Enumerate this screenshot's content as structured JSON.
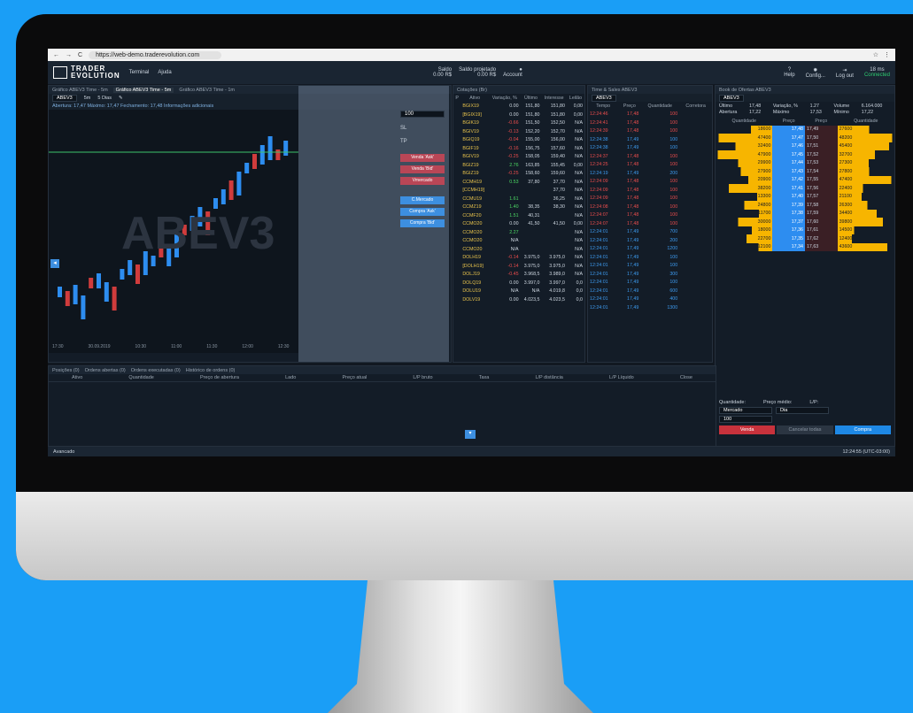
{
  "browser": {
    "url": "https://web-demo.traderevolution.com"
  },
  "header": {
    "logo_top": "TRADER",
    "logo_bottom": "EVOLUTION",
    "menu": [
      "Terminal",
      "Ajuda"
    ],
    "saldo_label": "Saldo",
    "saldo_value": "0.00 R$",
    "proj_label": "Saldo projetado",
    "proj_value": "0.00 R$",
    "account": "Account",
    "help": "Help",
    "config": "Config...",
    "logout": "Log out",
    "latency": "18 ms",
    "connected": "Connected"
  },
  "chart": {
    "tabs": [
      "Gráfico ABEV3 Time - 5m",
      "Gráfico ABEV3 Time - 5m",
      "Gráfico ABEV3 Time - 1m"
    ],
    "symbol": "ABEV3",
    "interval": "5m",
    "period": "5 Dias",
    "info": "Abertura: 17,47  Máximo: 17,47  Fechamento: 17,48  Informações adicionais",
    "watermark": "ABEV3",
    "qty": "100",
    "sl": "SL",
    "tp": "TP",
    "buttons": [
      "Venda 'Ask'",
      "Venda 'Bid'",
      "Vmercado",
      "C.Mercado",
      "Compra 'Ask'",
      "Compra 'Bid'"
    ],
    "times": [
      "17:30",
      "30.09.2019",
      "10:30",
      "11:00",
      "11:30",
      "12:00",
      "12:30"
    ]
  },
  "watch": {
    "title": "Cotações (Br)",
    "headers": [
      "P",
      "Ativo",
      "Variação, %",
      "Último",
      "Interesse",
      "Leilão"
    ],
    "rows": [
      [
        "BGIX19",
        "0.00",
        "151,80",
        "151,80",
        "0,00"
      ],
      [
        "[BGIX19]",
        "0.00",
        "151,80",
        "151,80",
        "0,00"
      ],
      [
        "BGIK19",
        "-0.66",
        "151,50",
        "152,50",
        "N/A"
      ],
      [
        "BGIV19",
        "-0.13",
        "152,20",
        "152,70",
        "N/A"
      ],
      [
        "BGIQ19",
        "-0.04",
        "155,00",
        "156,00",
        "N/A"
      ],
      [
        "BGIF19",
        "-0.16",
        "156,75",
        "157,60",
        "N/A"
      ],
      [
        "BGIV19",
        "-0.25",
        "158,05",
        "159,40",
        "N/A"
      ],
      [
        "BGIZ19",
        "2.76",
        "163,85",
        "155,45",
        "0,00"
      ],
      [
        "BGIZ19",
        "-0.25",
        "158,60",
        "159,60",
        "N/A"
      ],
      [
        "CCMH19",
        "0.53",
        "37,80",
        "37,70",
        "N/A"
      ],
      [
        "[CCMH19]",
        "",
        "",
        "37,70",
        "N/A"
      ],
      [
        "CCMU19",
        "1.61",
        "",
        "36,25",
        "N/A"
      ],
      [
        "CCMZ19",
        "1.40",
        "38,35",
        "38,30",
        "N/A"
      ],
      [
        "CCMF20",
        "1.51",
        "40,31",
        "",
        "N/A"
      ],
      [
        "CCMO20",
        "0.00",
        "41,50",
        "41,50",
        "0,00"
      ],
      [
        "CCMO20",
        "2.27",
        "",
        "",
        "N/A"
      ],
      [
        "CCMO20",
        "N/A",
        "",
        "",
        "N/A"
      ],
      [
        "CCMO20",
        "N/A",
        "",
        "",
        "N/A"
      ],
      [
        "DOLH19",
        "-0.14",
        "3.975,0",
        "3.975,0",
        "N/A"
      ],
      [
        "[DOLH19]",
        "-0.14",
        "3.975,0",
        "3.975,0",
        "N/A"
      ],
      [
        "DOLJ19",
        "-0.45",
        "3.968,5",
        "3.989,0",
        "N/A"
      ],
      [
        "DOLQ19",
        "0.00",
        "3.997,0",
        "3.997,0",
        "0,0"
      ],
      [
        "DOLU19",
        "N/A",
        "N/A",
        "4.019,8",
        "0,0"
      ],
      [
        "DOLV19",
        "0.00",
        "4.023,5",
        "4.023,5",
        "0,0"
      ]
    ]
  },
  "ts": {
    "title": "Time & Sales ABEV3",
    "symbol": "ABEV3",
    "headers": [
      "Tempo",
      "Preço",
      "Quantidade",
      "Corretora"
    ],
    "rows": [
      [
        "12:24:46",
        "17,48",
        "100"
      ],
      [
        "12:24:41",
        "17,48",
        "100"
      ],
      [
        "12:24:39",
        "17,48",
        "100"
      ],
      [
        "12:24:38",
        "17,49",
        "100"
      ],
      [
        "12:24:38",
        "17,49",
        "100"
      ],
      [
        "12:24:37",
        "17,48",
        "100"
      ],
      [
        "12:24:25",
        "17,48",
        "100"
      ],
      [
        "12:24:19",
        "17,49",
        "200"
      ],
      [
        "12:24:09",
        "17,48",
        "100"
      ],
      [
        "12:24:09",
        "17,48",
        "100"
      ],
      [
        "12:24:09",
        "17,48",
        "100"
      ],
      [
        "12:24:08",
        "17,48",
        "100"
      ],
      [
        "12:24:07",
        "17,48",
        "100"
      ],
      [
        "12:24:07",
        "17,48",
        "100"
      ],
      [
        "12:24:01",
        "17,49",
        "700"
      ],
      [
        "12:24:01",
        "17,49",
        "200"
      ],
      [
        "12:24:01",
        "17,49",
        "1200"
      ],
      [
        "12:24:01",
        "17,49",
        "100"
      ],
      [
        "12:24:01",
        "17,49",
        "100"
      ],
      [
        "12:24:01",
        "17,49",
        "300"
      ],
      [
        "12:24:01",
        "17,49",
        "100"
      ],
      [
        "12:24:01",
        "17,49",
        "600"
      ],
      [
        "12:24:01",
        "17,49",
        "400"
      ],
      [
        "12:24:01",
        "17,49",
        "1300"
      ]
    ]
  },
  "book": {
    "title": "Book de Ofertas ABEV3",
    "symbol": "ABEV3",
    "stats": [
      [
        "Último",
        "17,48"
      ],
      [
        "Variação, %",
        "1.27"
      ],
      [
        "Volume",
        "6.164.000"
      ],
      [
        "Abertura",
        "17,22"
      ],
      [
        "Máximo",
        "17,53"
      ],
      [
        "Mínimo",
        "17,22"
      ]
    ],
    "headers": [
      "Quantidade",
      "Preço",
      "Preço",
      "Quantidade"
    ],
    "rows": [
      [
        "18600",
        "17,48",
        "17,49",
        "27600"
      ],
      [
        "47400",
        "17,47",
        "17,50",
        "48200"
      ],
      [
        "32400",
        "17,46",
        "17,51",
        "45400"
      ],
      [
        "47900",
        "17,45",
        "17,52",
        "32700"
      ],
      [
        "29900",
        "17,44",
        "17,53",
        "27300"
      ],
      [
        "27900",
        "17,43",
        "17,54",
        "27800"
      ],
      [
        "20900",
        "17,42",
        "17,55",
        "47400"
      ],
      [
        "38200",
        "17,41",
        "17,56",
        "22400"
      ],
      [
        "13300",
        "17,40",
        "17,57",
        "21100"
      ],
      [
        "24800",
        "17,39",
        "17,58",
        "26300"
      ],
      [
        "11700",
        "17,38",
        "17,59",
        "34400"
      ],
      [
        "30000",
        "17,37",
        "17,60",
        "39800"
      ],
      [
        "18000",
        "17,36",
        "17,61",
        "14500"
      ],
      [
        "22700",
        "17,35",
        "17,62",
        "12400"
      ],
      [
        "12100",
        "17,34",
        "17,63",
        "43600"
      ]
    ],
    "form": {
      "qty_label": "Quantidade:",
      "price_label": "Preço médio:",
      "lp_label": "L/P:",
      "type": "Mercado",
      "tif": "Dia",
      "qty": "100",
      "sell": "Venda",
      "cancel": "Cancelar todas",
      "buy": "Compra"
    }
  },
  "bottom": {
    "tabs": [
      "Posições (0)",
      "Ordens abertas (0)",
      "Ordens executadas (0)",
      "Histórico de ordens (0)"
    ],
    "headers": [
      "Ativo",
      "Quantidade",
      "Preço de abertura",
      "Lado",
      "Preço atual",
      "L/P bruto",
      "Taxa",
      "L/P distância",
      "L/P Líquido",
      "Close"
    ]
  },
  "status": {
    "mode": "Avancado",
    "time": "12:24:55 (UTC-03:00)"
  },
  "colors": {
    "ask": "#f7b500",
    "bid": "#2d8df0",
    "sell": "#c8323c",
    "buy": "#1e88e5",
    "up": "#2d8df0",
    "down": "#d03c3c"
  }
}
